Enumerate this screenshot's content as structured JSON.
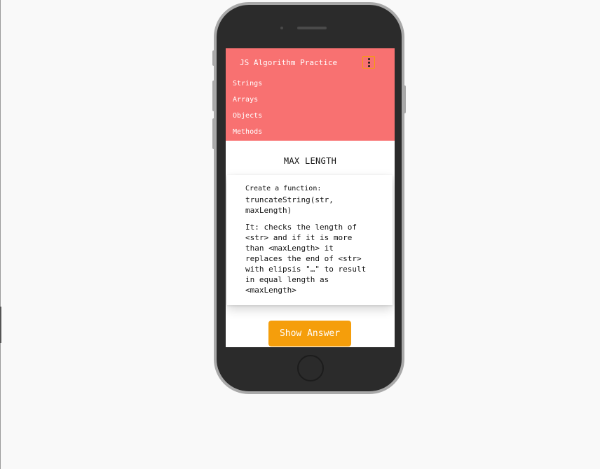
{
  "app": {
    "title": "JS Algorithm Practice"
  },
  "menu": {
    "icon": "kebab-menu-icon"
  },
  "nav": {
    "items": [
      {
        "label": "Strings"
      },
      {
        "label": "Arrays"
      },
      {
        "label": "Objects"
      },
      {
        "label": "Methods"
      }
    ]
  },
  "page": {
    "title": "MAX LENGTH"
  },
  "card": {
    "intro": "Create a function:",
    "signature": "truncateString(str, maxLength)",
    "description": "It: checks the length of <str> and if it is more than <maxLength> it replaces the end of <str> with elipsis \"…\" to result in equal length as <maxLength>"
  },
  "actions": {
    "show_answer": "Show Answer"
  },
  "colors": {
    "header": "#f87171",
    "accent": "#f59e0b",
    "background": "#f9f9f9",
    "phone_body": "#2b2b2b"
  }
}
